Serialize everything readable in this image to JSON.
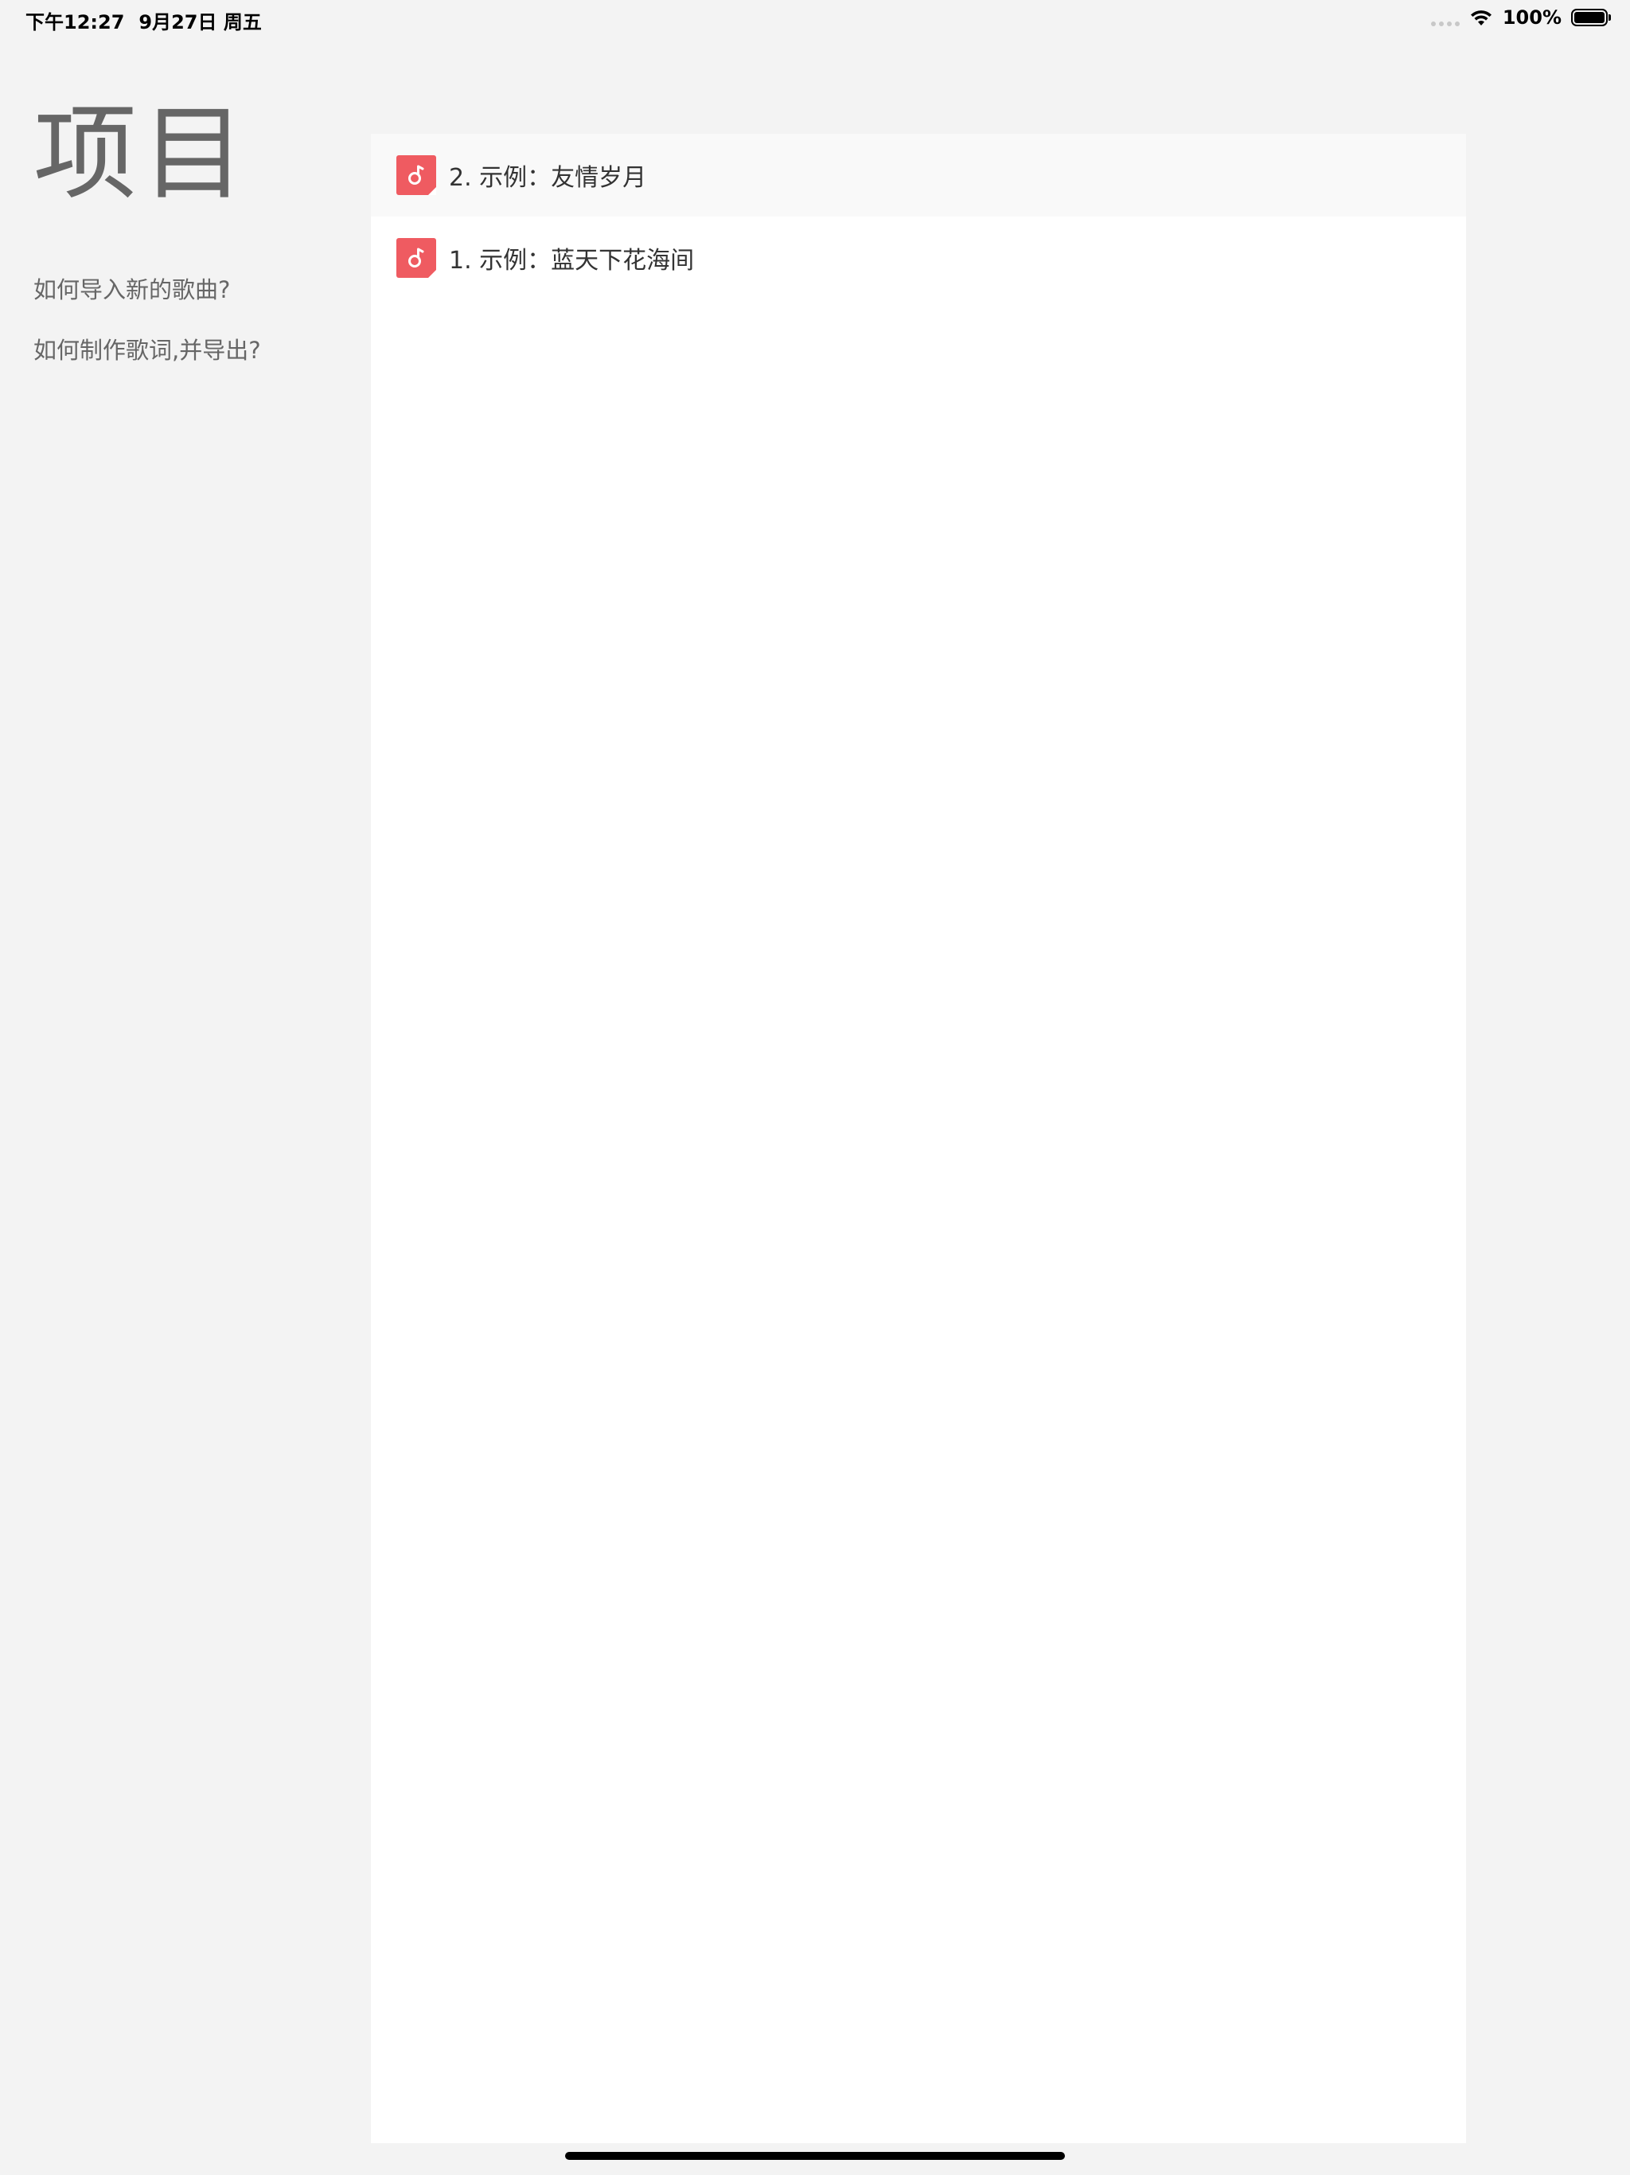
{
  "status_bar": {
    "time": "下午12:27",
    "date": "9月27日 周五",
    "battery_text": "100%",
    "icons": [
      "signal-dots-icon",
      "wifi-icon",
      "battery-icon"
    ]
  },
  "sidebar": {
    "title": "项目",
    "links": [
      {
        "label": "如何导入新的歌曲?"
      },
      {
        "label": "如何制作歌词,并导出?"
      }
    ]
  },
  "song_list": {
    "icon": "music-note-icon",
    "accent_color": "#ef5b61",
    "items": [
      {
        "label": "2. 示例：友情岁月"
      },
      {
        "label": "1. 示例：蓝天下花海间"
      }
    ]
  }
}
